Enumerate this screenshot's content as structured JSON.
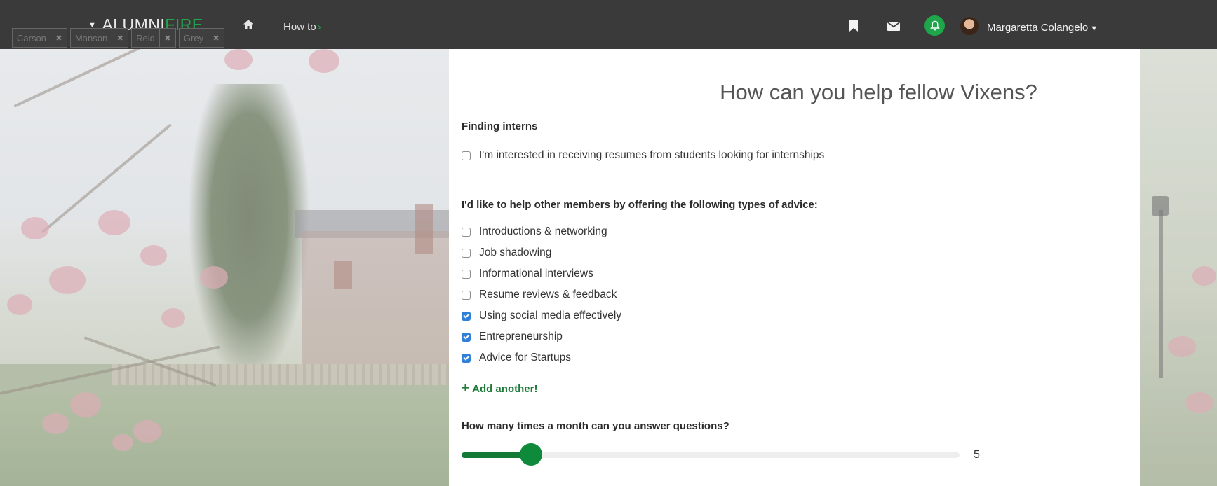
{
  "navbar": {
    "brand_left": "ALUMNI",
    "brand_accent": "FIRE",
    "howto_label": "How to",
    "howto_arrow": "›",
    "user_name": "Margaretta Colangelo"
  },
  "search": {
    "tags": [
      "Carson",
      "Manson",
      "Reid",
      "Grey"
    ]
  },
  "help_form": {
    "headline": "How can you help fellow Vixens?",
    "interns_section": "Finding interns",
    "interns_option": {
      "label": "I'm interested in receiving resumes from students looking for internships",
      "checked": false
    },
    "advice_section": "I'd like to help other members by offering the following types of advice:",
    "advice_options": [
      {
        "label": "Introductions & networking",
        "checked": false
      },
      {
        "label": "Job shadowing",
        "checked": false
      },
      {
        "label": "Informational interviews",
        "checked": false
      },
      {
        "label": "Resume reviews & feedback",
        "checked": false
      },
      {
        "label": "Using social media effectively",
        "checked": true
      },
      {
        "label": "Entrepreneurship",
        "checked": true
      },
      {
        "label": "Advice for Startups",
        "checked": true
      }
    ],
    "add_another": "Add another!",
    "frequency_question": "How many times a month can you answer questions?",
    "frequency_value": "5",
    "frequency_fraction": 0.14
  },
  "colors": {
    "accent_green": "#1fa64a",
    "navbar_bg": "#3a3a3a",
    "checkbox_blue": "#2f80d6"
  }
}
